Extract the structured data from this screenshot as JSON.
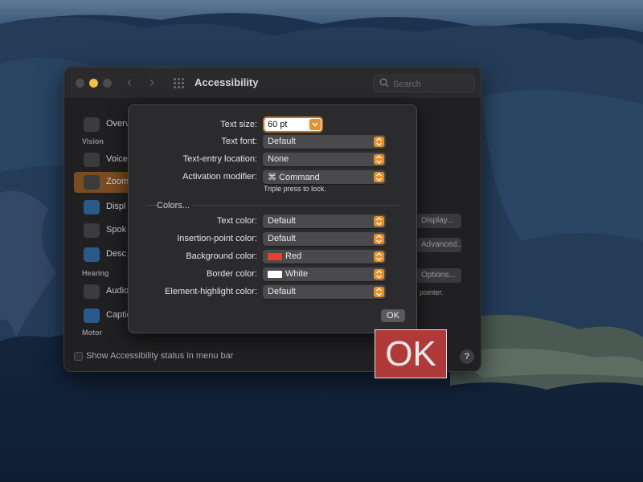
{
  "window": {
    "title": "Accessibility",
    "search_placeholder": "Search"
  },
  "sidebar": {
    "items": [
      {
        "label": "Overv",
        "icon": "accessibility-icon",
        "color": "#3b3b3d"
      },
      {
        "label": "Voice",
        "icon": "voiceover-icon",
        "color": "#3b3b3d"
      },
      {
        "label": "Zoom",
        "icon": "zoom-icon",
        "color": "#3b3b3d"
      },
      {
        "label": "Displ",
        "icon": "display-icon",
        "color": "#2b5a8a"
      },
      {
        "label": "Spok",
        "icon": "spoken-content-icon",
        "color": "#3b3b3d"
      },
      {
        "label": "Desc",
        "icon": "descriptions-icon",
        "color": "#2b5a8a"
      },
      {
        "label": "Audio",
        "icon": "audio-icon",
        "color": "#3b3b3d"
      },
      {
        "label": "Captio",
        "icon": "captions-icon",
        "color": "#2b5a8a"
      }
    ],
    "sections": {
      "vision": "Vision",
      "hearing": "Hearing",
      "motor": "Motor"
    }
  },
  "background": {
    "display_button": "Display...",
    "advanced_button": "Advanced...",
    "options_button": "Options...",
    "pointer_text": "pointer."
  },
  "footer": {
    "status_checkbox_label": "Show Accessibility status in menu bar",
    "help": "?"
  },
  "sheet": {
    "text_size_label": "Text size:",
    "text_size_value": "60 pt",
    "text_font_label": "Text font:",
    "text_font_value": "Default",
    "text_entry_label": "Text-entry location:",
    "text_entry_value": "None",
    "activation_label": "Activation modifier:",
    "activation_value": "⌘ Command",
    "activation_hint": "Triple press to lock.",
    "colors_title": "Colors...",
    "text_color_label": "Text color:",
    "text_color_value": "Default",
    "insertion_label": "Insertion-point color:",
    "insertion_value": "Default",
    "background_label": "Background color:",
    "background_value": "Red",
    "background_swatch": "#e8402e",
    "border_label": "Border color:",
    "border_value": "White",
    "border_swatch": "#ffffff",
    "highlight_label": "Element-highlight color:",
    "highlight_value": "Default",
    "ok_label": "OK"
  },
  "hover_text": {
    "text": "OK"
  },
  "colors": {
    "accent": "#e68f2e",
    "selected_sidebar": "#7a4c22",
    "hover_background": "#b03a3a"
  }
}
